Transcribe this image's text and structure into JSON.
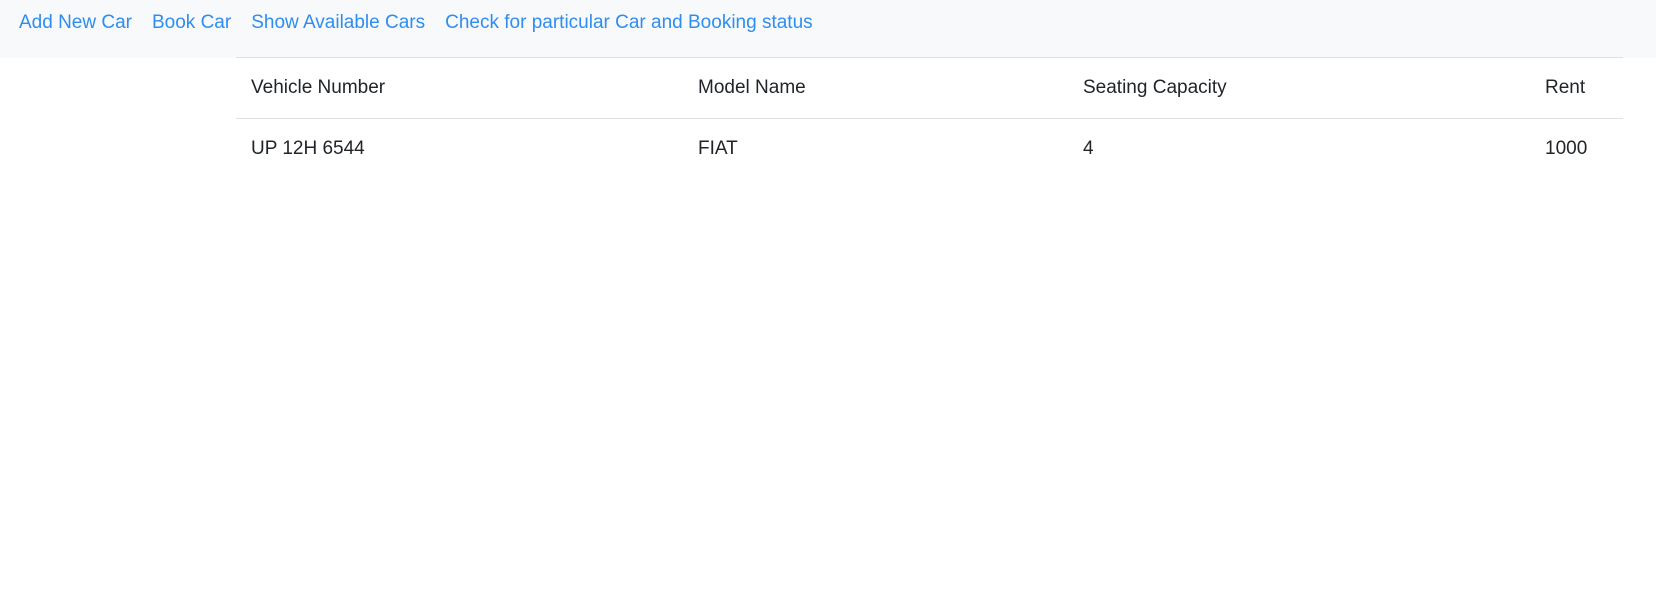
{
  "nav": {
    "links": [
      {
        "label": "Add New Car"
      },
      {
        "label": "Book Car"
      },
      {
        "label": "Show Available Cars"
      },
      {
        "label": "Check for particular Car and Booking status"
      }
    ]
  },
  "table": {
    "headers": [
      "Vehicle Number",
      "Model Name",
      "Seating Capacity",
      "Rent"
    ],
    "rows": [
      [
        "UP 12H 6544",
        "FIAT",
        "4",
        "1000"
      ]
    ]
  },
  "colors": {
    "navbar_bg": "#f8f9fa",
    "link": "#2f8df0",
    "text": "#212529",
    "border": "#dee2e6"
  }
}
